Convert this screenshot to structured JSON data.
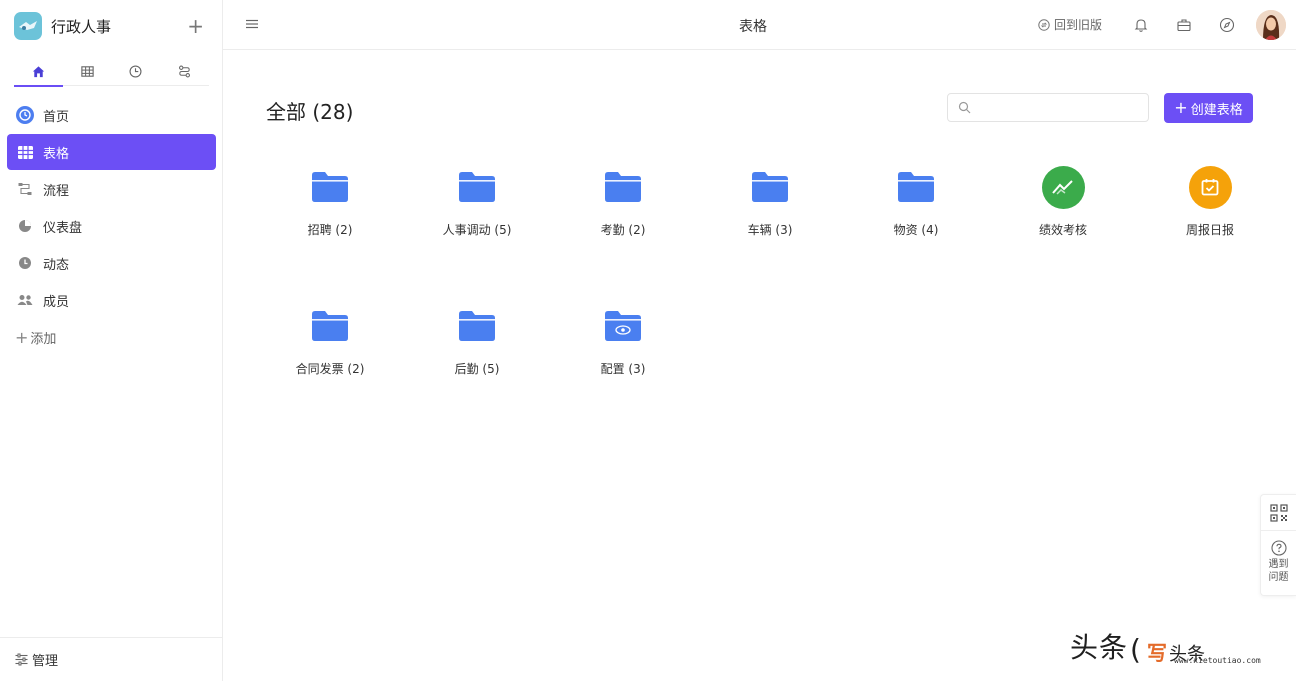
{
  "app": {
    "name": "行政人事"
  },
  "sidebar": {
    "nav": [
      {
        "label": "首页",
        "icon": "home-circle-icon"
      },
      {
        "label": "表格",
        "icon": "table-icon"
      },
      {
        "label": "流程",
        "icon": "flow-icon"
      },
      {
        "label": "仪表盘",
        "icon": "dashboard-icon"
      },
      {
        "label": "动态",
        "icon": "clock-icon"
      },
      {
        "label": "成员",
        "icon": "members-icon"
      }
    ],
    "add_label": "添加",
    "manage_label": "管理"
  },
  "topbar": {
    "title": "表格",
    "old_version_label": "回到旧版"
  },
  "main": {
    "title": "全部 (28)",
    "search": {
      "placeholder": ""
    },
    "create_label": "创建表格",
    "tiles": [
      {
        "label": "招聘 (2)",
        "icon": "folder-icon"
      },
      {
        "label": "人事调动 (5)",
        "icon": "folder-icon"
      },
      {
        "label": "考勤 (2)",
        "icon": "folder-icon"
      },
      {
        "label": "车辆 (3)",
        "icon": "folder-icon"
      },
      {
        "label": "物资 (4)",
        "icon": "folder-icon"
      },
      {
        "label": "绩效考核",
        "icon": "trend-icon",
        "color": "#3bab4b"
      },
      {
        "label": "周报日报",
        "icon": "calendar-check-icon",
        "color": "#f5a20a"
      },
      {
        "label": "合同发票 (2)",
        "icon": "folder-icon"
      },
      {
        "label": "后勤 (5)",
        "icon": "folder-icon"
      },
      {
        "label": "配置 (3)",
        "icon": "folder-eye-icon"
      }
    ]
  },
  "float_panel": {
    "help_label": "遇到问题"
  },
  "watermark": {
    "main": "头条",
    "sub": "头条",
    "logo": "写",
    "url": "www.xietoutiao.com"
  },
  "colors": {
    "accent": "#6c4ff5",
    "folder": "#4a7ff0"
  }
}
